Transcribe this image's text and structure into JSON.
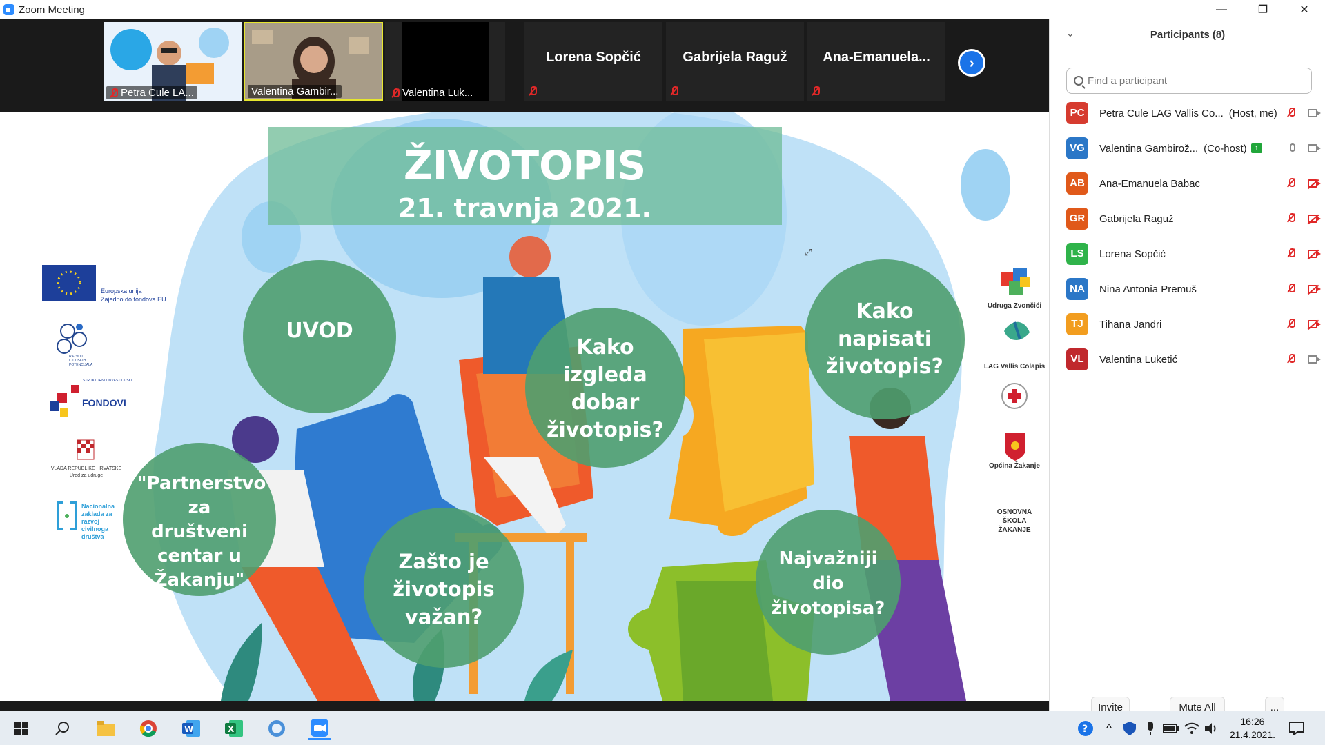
{
  "window": {
    "title": "Zoom Meeting",
    "minimize": "—",
    "restore": "❐",
    "close": "✕"
  },
  "video_strip": {
    "tiles": [
      {
        "name": "Petra Cule LA...",
        "type": "video"
      },
      {
        "name": "Valentina Gambir...",
        "type": "video",
        "active_speaker": true
      },
      {
        "name": "Valentina Luk...",
        "type": "video-off"
      },
      {
        "name": "Lorena Sopčić",
        "type": "name-only"
      },
      {
        "name": "Gabrijela Raguž",
        "type": "name-only"
      },
      {
        "name": "Ana-Emanuela...",
        "type": "name-only"
      }
    ],
    "next_arrow": "›"
  },
  "slide": {
    "title": "ŽIVOTOPIS",
    "date": "21. travnja 2021.",
    "bubbles": [
      {
        "text": "UVOD"
      },
      {
        "text": "Kako izgleda dobar životopis?"
      },
      {
        "text": "Kako napisati životopis?"
      },
      {
        "text": "\"Partnerstvo za društveni centar u Žakanju\""
      },
      {
        "text": "Zašto je životopis važan?"
      },
      {
        "text": "Najvažniji dio životopisa?"
      }
    ],
    "left_logos": {
      "eu_line1": "Europska unija",
      "eu_line2": "Zajedno do fondova EU",
      "razvoj_line1": "RAZVOJ",
      "razvoj_line2": "LJUDSKIH",
      "razvoj_line3": "POTENCIJALA",
      "fondovi_small": "STRUKTURNI I INVESTICIJSKI",
      "fondovi": "FONDOVI",
      "vlada_line1": "VLADA REPUBLIKE HRVATSKE",
      "vlada_line2": "Ured za udruge",
      "nz_line1": "Nacionalna",
      "nz_line2": "zaklada za",
      "nz_line3": "razvoj",
      "nz_line4": "civilnoga",
      "nz_line5": "društva"
    },
    "right_logos": {
      "udruga": "Udruga Zvončići",
      "lag": "LAG Vallis Colapis",
      "opcina": "Općina Žakanje",
      "skola_line1": "OSNOVNA",
      "skola_line2": "ŠKOLA",
      "skola_line3": "ŽAKANJE"
    }
  },
  "participants_panel": {
    "header": "Participants (8)",
    "search_placeholder": "Find a participant",
    "participants": [
      {
        "initials": "PC",
        "name": "Petra Cule LAG Vallis Co...",
        "tag": "(Host, me)",
        "color": "#d63b2f",
        "mic": "muted",
        "video": "on"
      },
      {
        "initials": "VG",
        "name": "Valentina Gambirož...",
        "tag": "(Co-host)",
        "color": "#2b77c7",
        "mic": "on",
        "video": "on",
        "sharing": true
      },
      {
        "initials": "AB",
        "name": "Ana-Emanuela Babac",
        "tag": "",
        "color": "#e0591a",
        "mic": "muted",
        "video": "off"
      },
      {
        "initials": "GR",
        "name": "Gabrijela Raguž",
        "tag": "",
        "color": "#e0591a",
        "mic": "muted",
        "video": "off"
      },
      {
        "initials": "LS",
        "name": "Lorena Sopčić",
        "tag": "",
        "color": "#2fb34a",
        "mic": "muted",
        "video": "off"
      },
      {
        "initials": "NA",
        "name": "Nina Antonia Premuš",
        "tag": "",
        "color": "#2b77c7",
        "mic": "muted",
        "video": "off"
      },
      {
        "initials": "TJ",
        "name": "Tihana Jandri",
        "tag": "",
        "color": "#f29d1f",
        "mic": "muted",
        "video": "off"
      },
      {
        "initials": "VL",
        "name": "Valentina Luketić",
        "tag": "",
        "color": "#c0282d",
        "mic": "muted",
        "video": "on"
      }
    ],
    "buttons": {
      "invite": "Invite",
      "mute_all": "Mute All",
      "more": "..."
    }
  },
  "taskbar": {
    "time": "16:26",
    "date": "21.4.2021."
  }
}
